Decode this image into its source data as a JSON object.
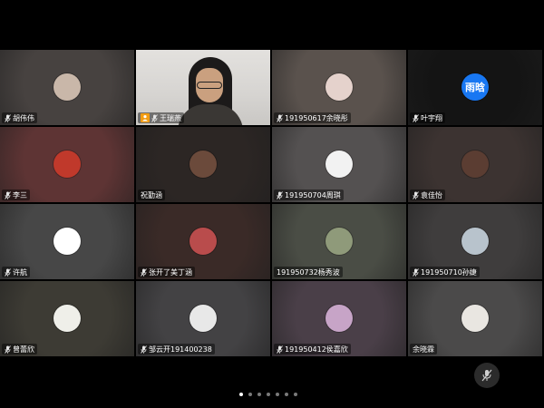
{
  "participants": [
    {
      "name": "胡伟伟",
      "bg": "#474240",
      "avatar": "#c9b7a9",
      "muted": true
    },
    {
      "name": "王瑞燕",
      "bg": "#d8d6d3",
      "muted": true,
      "host": true,
      "video": true
    },
    {
      "name": "191950617余晓彤",
      "bg": "#5a524d",
      "avatar": "#e5d2cc",
      "muted": true
    },
    {
      "name": "叶宇翔",
      "bg": "#141414",
      "avatar_text": "雨晗",
      "muted": true
    },
    {
      "name": "李三",
      "bg": "#5e3434",
      "avatar": "#c0392b",
      "muted": true
    },
    {
      "name": "祝勤涵",
      "bg": "#2c2624",
      "avatar": "#6b4a3b",
      "muted": false
    },
    {
      "name": "191950704周琪",
      "bg": "#545151",
      "avatar": "#f2f2f2",
      "muted": true
    },
    {
      "name": "袁佳怡",
      "bg": "#3c3331",
      "avatar": "#5b3d32",
      "muted": true
    },
    {
      "name": "许航",
      "bg": "#474747",
      "avatar": "#ffffff",
      "muted": true
    },
    {
      "name": "张开了美丁涵",
      "bg": "#3a2a27",
      "avatar": "#b94c4c",
      "muted": true
    },
    {
      "name": "191950732杨秀波",
      "bg": "#4a4d45",
      "avatar": "#8f9a7a",
      "muted": false
    },
    {
      "name": "191950710孙婕",
      "bg": "#3f3d3d",
      "avatar": "#b8c3cc",
      "muted": true
    },
    {
      "name": "曾蕾欣",
      "bg": "#3d3b34",
      "avatar": "#efefe9",
      "muted": true
    },
    {
      "name": "邹云开191400238",
      "bg": "#434244",
      "avatar": "#e8e8e8",
      "muted": true
    },
    {
      "name": "191950412侯嘉欣",
      "bg": "#4a3f48",
      "avatar": "#c7a4c7",
      "muted": true
    },
    {
      "name": "余晓霖",
      "bg": "#4b4a4a",
      "avatar": "#e9e6e1",
      "muted": false
    }
  ],
  "pagination": {
    "count": 7,
    "active": 0
  },
  "colors": {
    "accent": "#2ecc71",
    "host_badge": "#f39c12",
    "avatar_text_bg": "#1877f2"
  },
  "icons": {
    "mic": "mic-off-icon",
    "host": "host-icon"
  }
}
